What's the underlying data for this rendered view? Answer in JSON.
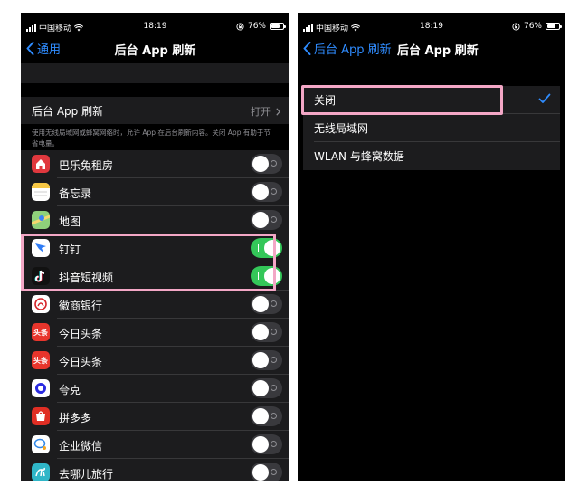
{
  "status_bar": {
    "carrier": "中国移动",
    "time": "18:19",
    "battery": "76%"
  },
  "left_screen": {
    "nav": {
      "back_label": "通用",
      "title": "后台 App 刷新"
    },
    "master": {
      "label": "后台 App 刷新",
      "value": "打开"
    },
    "description": "使用无线局域网或蜂窝网络时，允许 App 在后台刷新内容。关闭 App 有助于节省电量。",
    "apps": [
      {
        "name": "巴乐兔租房",
        "icon": "rabbit-house-icon",
        "on": false,
        "icon_bg": "#e0383e",
        "icon_fg": "#ffffff"
      },
      {
        "name": "备忘录",
        "icon": "notes-icon",
        "on": false,
        "icon_bg": "#ffffff",
        "icon_fg": "#f7c744"
      },
      {
        "name": "地图",
        "icon": "maps-icon",
        "on": false,
        "icon_bg": "#8fd07a",
        "icon_fg": "#3b82f6"
      },
      {
        "name": "钉钉",
        "icon": "dingtalk-icon",
        "on": true,
        "icon_bg": "#ffffff",
        "icon_fg": "#2f7cf6"
      },
      {
        "name": "抖音短视频",
        "icon": "douyin-icon",
        "on": true,
        "icon_bg": "#111111",
        "icon_fg": "#ffffff"
      },
      {
        "name": "徽商银行",
        "icon": "bank-icon",
        "on": false,
        "icon_bg": "#ffffff",
        "icon_fg": "#d6262c"
      },
      {
        "name": "今日头条",
        "icon": "toutiao-icon",
        "on": false,
        "icon_bg": "#e8352c",
        "icon_fg": "#ffffff",
        "icon_text": "头条"
      },
      {
        "name": "今日头条",
        "icon": "toutiao-icon",
        "on": false,
        "icon_bg": "#e8352c",
        "icon_fg": "#ffffff",
        "icon_text": "头条"
      },
      {
        "name": "夸克",
        "icon": "quark-icon",
        "on": false,
        "icon_bg": "#ffffff",
        "icon_fg": "#2a2ae0"
      },
      {
        "name": "拼多多",
        "icon": "pinduoduo-icon",
        "on": false,
        "icon_bg": "#e02e24",
        "icon_fg": "#ffffff"
      },
      {
        "name": "企业微信",
        "icon": "wecom-icon",
        "on": false,
        "icon_bg": "#ffffff",
        "icon_fg": "#2f87e8"
      },
      {
        "name": "去哪儿旅行",
        "icon": "qunar-icon",
        "on": false,
        "icon_bg": "#2fb6c8",
        "icon_fg": "#ffffff"
      }
    ]
  },
  "right_screen": {
    "nav": {
      "back_label": "后台 App 刷新",
      "title": "后台 App 刷新"
    },
    "options": [
      {
        "label": "关闭",
        "selected": true
      },
      {
        "label": "无线局域网",
        "selected": false
      },
      {
        "label": "WLAN 与蜂窝数据",
        "selected": false
      }
    ]
  },
  "colors": {
    "accent": "#2f8cff",
    "toggle_on": "#34c759",
    "highlight": "#f3a7c6"
  }
}
